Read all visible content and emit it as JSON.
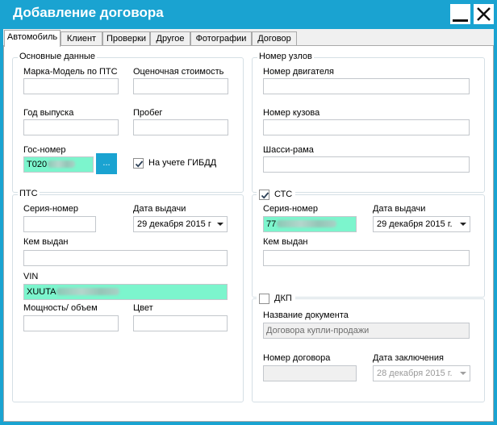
{
  "window": {
    "title": "Добавление договора"
  },
  "tabs": [
    {
      "label": "Автомобиль",
      "active": true
    },
    {
      "label": "Клиент"
    },
    {
      "label": "Проверки"
    },
    {
      "label": "Другое"
    },
    {
      "label": "Фотографии"
    },
    {
      "label": "Договор"
    }
  ],
  "basic": {
    "title": "Основные данные",
    "make_model_label": "Марка-Модель по ПТС",
    "make_model_value": "",
    "estimated_cost_label": "Оценочная стоимость",
    "estimated_cost_value": "",
    "year_label": "Год выпуска",
    "year_value": "",
    "mileage_label": "Пробег",
    "mileage_value": "",
    "plate_label": "Гос-номер",
    "plate_value": "Т020",
    "browse_button": "...",
    "gibdd_label": "На учете ГИБДД",
    "gibdd_checked": true
  },
  "units": {
    "title": "Номер узлов",
    "engine_label": "Номер двигателя",
    "engine_value": "",
    "body_label": "Номер кузова",
    "body_value": "",
    "chassis_label": "Шасси-рама",
    "chassis_value": ""
  },
  "pts": {
    "title": "ПТС",
    "series_label": "Серия-номер",
    "series_value": "",
    "issue_date_label": "Дата выдачи",
    "issue_date_value": "29 декабря  2015 г",
    "issued_by_label": "Кем выдан",
    "issued_by_value": "",
    "vin_label": "VIN",
    "vin_value": "XUUTA",
    "power_label": "Мощность/ объем",
    "power_value": "",
    "color_label": "Цвет",
    "color_value": ""
  },
  "sts": {
    "title": "СТС",
    "checked": true,
    "series_label": "Серия-номер",
    "series_value": "77",
    "issue_date_label": "Дата выдачи",
    "issue_date_value": "29  декабря  2015 г.",
    "issued_by_label": "Кем выдан",
    "issued_by_value": ""
  },
  "dkp": {
    "title": "ДКП",
    "checked": false,
    "doc_name_label": "Название документа",
    "doc_name_value": "Договора купли-продажи",
    "contract_no_label": "Номер договора",
    "contract_no_value": "",
    "conclusion_date_label": "Дата заключения",
    "conclusion_date_value": "28  декабря  2015 г."
  },
  "colors": {
    "accent": "#1aa3d1",
    "highlight": "#7cf5cd",
    "group_border": "#d5dfe5"
  }
}
